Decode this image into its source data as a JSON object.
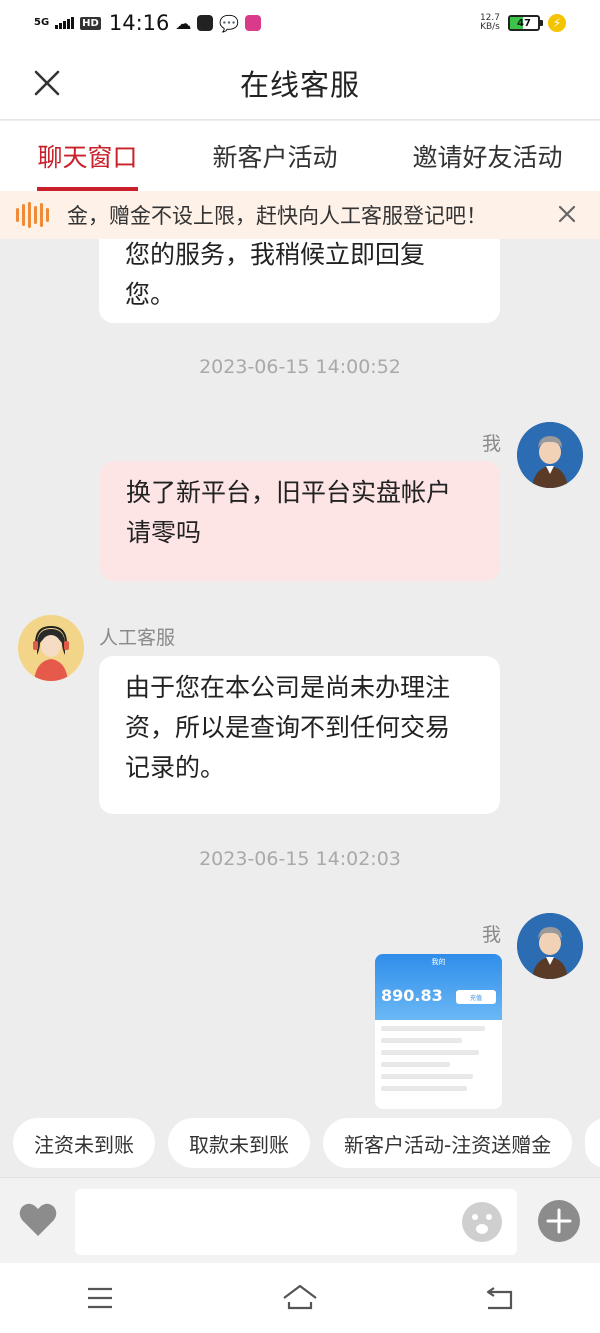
{
  "status_bar": {
    "network": "5G",
    "hd_badge": "HD",
    "time": "14:16",
    "net_speed_value": "12.7",
    "net_speed_unit": "KB/s",
    "battery": "47",
    "battery_level": 0.47
  },
  "header": {
    "title": "在线客服",
    "close_icon": "close-icon"
  },
  "tabs": [
    {
      "label": "聊天窗口",
      "active": true
    },
    {
      "label": "新客户活动",
      "active": false
    },
    {
      "label": "邀请好友活动",
      "active": false
    }
  ],
  "notice": {
    "text": "金，赠金不设上限，赶快向人工客服登记吧！",
    "icon": "sound-wave-icon",
    "close_icon": "close-icon",
    "accent": "#f08a36"
  },
  "messages": {
    "m0": {
      "sender": "",
      "text": "您的服务，我稍候立即回复您。"
    },
    "ts1": "2023-06-15 14:00:52",
    "m1": {
      "sender": "我",
      "text": "换了新平台，旧平台实盘帐户请零吗"
    },
    "m2": {
      "sender": "人工客服",
      "text": "由于您在本公司是尚未办理注资，所以是查询不到任何交易记录的。"
    },
    "ts2": "2023-06-15 14:02:03",
    "m3": {
      "sender": "我",
      "image": {
        "title": "我的",
        "amount": "890.83",
        "button": "充值"
      }
    }
  },
  "quick_replies": [
    "注资未到账",
    "取款未到账",
    "新客户活动-注资送赠金"
  ],
  "input": {
    "placeholder": "",
    "value": "",
    "heart_icon": "heart-icon",
    "emoji_icon": "emoji-icon",
    "plus_icon": "plus-icon"
  },
  "nav": [
    "menu-icon",
    "home-icon",
    "back-icon"
  ],
  "colors": {
    "accent": "#c9202a",
    "my_bubble": "#fde4e5",
    "background": "#ededed"
  }
}
